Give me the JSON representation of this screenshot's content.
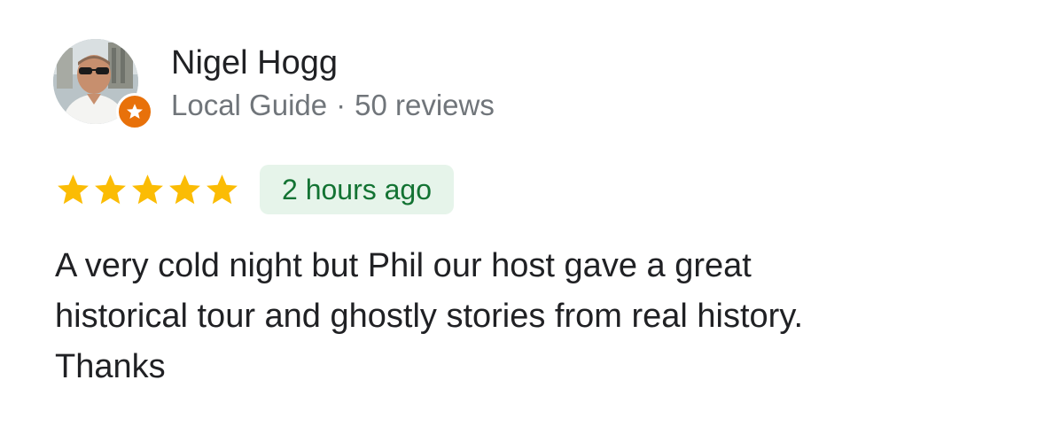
{
  "reviewer": {
    "name": "Nigel Hogg",
    "badge": "Local Guide",
    "separator": "·",
    "review_count": "50 reviews",
    "avatar": "profile-photo",
    "badge_icon": "local-guide-star-icon"
  },
  "review": {
    "rating": 5,
    "rating_max": 5,
    "time": "2 hours ago",
    "text": "A very cold night but Phil our host gave  a great\nhistorical tour and ghostly stories from real history.\nThanks"
  },
  "colors": {
    "star": "#fbbc04",
    "badge": "#e8710a",
    "chip_bg": "#e6f4ea",
    "chip_text": "#137333",
    "secondary_text": "#70757a"
  }
}
